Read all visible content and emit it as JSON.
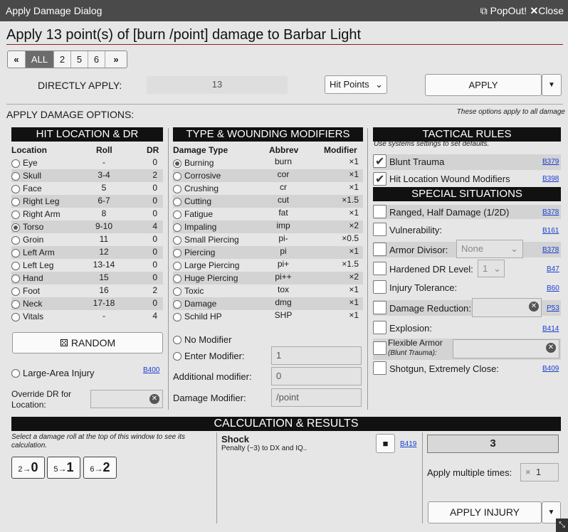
{
  "window": {
    "title": "Apply Damage Dialog",
    "popout": "PopOut!",
    "close": "Close"
  },
  "header": "Apply 13 point(s) of [burn /point] damage to Barbar Light",
  "pager": [
    "«",
    "ALL",
    "2",
    "5",
    "6",
    "»"
  ],
  "direct": {
    "label": "DIRECTLY APPLY:",
    "value": "13",
    "select": "Hit Points",
    "apply": "APPLY"
  },
  "options": {
    "title": "APPLY DAMAGE OPTIONS:",
    "note": "These options apply to all damage"
  },
  "hitloc": {
    "title": "HIT LOCATION & DR",
    "headers": [
      "Location",
      "Roll",
      "DR"
    ],
    "rows": [
      {
        "loc": "Eye",
        "roll": "-",
        "dr": "0"
      },
      {
        "loc": "Skull",
        "roll": "3-4",
        "dr": "2"
      },
      {
        "loc": "Face",
        "roll": "5",
        "dr": "0"
      },
      {
        "loc": "Right Leg",
        "roll": "6-7",
        "dr": "0"
      },
      {
        "loc": "Right Arm",
        "roll": "8",
        "dr": "0"
      },
      {
        "loc": "Torso",
        "roll": "9-10",
        "dr": "4"
      },
      {
        "loc": "Groin",
        "roll": "11",
        "dr": "0"
      },
      {
        "loc": "Left Arm",
        "roll": "12",
        "dr": "0"
      },
      {
        "loc": "Left Leg",
        "roll": "13-14",
        "dr": "0"
      },
      {
        "loc": "Hand",
        "roll": "15",
        "dr": "0"
      },
      {
        "loc": "Foot",
        "roll": "16",
        "dr": "2"
      },
      {
        "loc": "Neck",
        "roll": "17-18",
        "dr": "0"
      },
      {
        "loc": "Vitals",
        "roll": "-",
        "dr": "4"
      }
    ],
    "random": "RANDOM",
    "large_area": "Large-Area Injury",
    "large_area_ref": "B400",
    "override": "Override DR for Location:"
  },
  "types": {
    "title": "TYPE & WOUNDING MODIFIERS",
    "headers": [
      "Damage Type",
      "Abbrev",
      "Modifier"
    ],
    "rows": [
      {
        "type": "Burning",
        "abbr": "burn",
        "mod": "×1"
      },
      {
        "type": "Corrosive",
        "abbr": "cor",
        "mod": "×1"
      },
      {
        "type": "Crushing",
        "abbr": "cr",
        "mod": "×1"
      },
      {
        "type": "Cutting",
        "abbr": "cut",
        "mod": "×1.5"
      },
      {
        "type": "Fatigue",
        "abbr": "fat",
        "mod": "×1"
      },
      {
        "type": "Impaling",
        "abbr": "imp",
        "mod": "×2"
      },
      {
        "type": "Small Piercing",
        "abbr": "pi-",
        "mod": "×0.5"
      },
      {
        "type": "Piercing",
        "abbr": "pi",
        "mod": "×1"
      },
      {
        "type": "Large Piercing",
        "abbr": "pi+",
        "mod": "×1.5"
      },
      {
        "type": "Huge Piercing",
        "abbr": "pi++",
        "mod": "×2"
      },
      {
        "type": "Toxic",
        "abbr": "tox",
        "mod": "×1"
      },
      {
        "type": "Damage",
        "abbr": "dmg",
        "mod": "×1"
      },
      {
        "type": "Schild HP",
        "abbr": "SHP",
        "mod": "×1"
      }
    ],
    "no_mod": "No Modifier",
    "enter_mod": "Enter Modifier:",
    "enter_mod_val": "1",
    "additional": "Additional modifier:",
    "additional_val": "0",
    "dmg_mod": "Damage Modifier:",
    "dmg_mod_val": "/point"
  },
  "tactical": {
    "title": "TACTICAL RULES",
    "note": "Use systems settings to set defaults.",
    "blunt": "Blunt Trauma",
    "blunt_ref": "B379",
    "hitwound": "Hit Location Wound Modifiers",
    "hitwound_ref": "B398"
  },
  "special": {
    "title": "SPECIAL SITUATIONS",
    "ranged": "Ranged, Half Damage (1/2D)",
    "ranged_ref": "B378",
    "vuln": "Vulnerability:",
    "vuln_ref": "B161",
    "armor": "Armor Divisor:",
    "armor_val": "None",
    "armor_ref": "B378",
    "hardened": "Hardened DR Level:",
    "hardened_val": "1",
    "hardened_ref": "B47",
    "injury_tol": "Injury Tolerance:",
    "injury_tol_ref": "B60",
    "dmg_red": "Damage Reduction:",
    "dmg_red_ref": "P53",
    "explosion": "Explosion:",
    "explosion_ref": "B414",
    "flex": "Flexible Armor",
    "flex_sub": "(Blunt Trauma):",
    "shotgun": "Shotgun, Extremely Close:",
    "shotgun_ref": "B409"
  },
  "calc": {
    "title": "CALCULATION & RESULTS",
    "hint": "Select a damage roll at the top of this window to see its calculation.",
    "rolls": [
      {
        "a": "2",
        "b": "0"
      },
      {
        "a": "5",
        "b": "1"
      },
      {
        "a": "6",
        "b": "2"
      }
    ],
    "shock": "Shock",
    "shock_desc": "Penalty (−3) to DX and IQ..",
    "shock_ref": "B419",
    "result": "3",
    "multiple": "Apply multiple times:",
    "multiple_x": "×",
    "multiple_val": "1",
    "apply_injury": "APPLY INJURY"
  }
}
